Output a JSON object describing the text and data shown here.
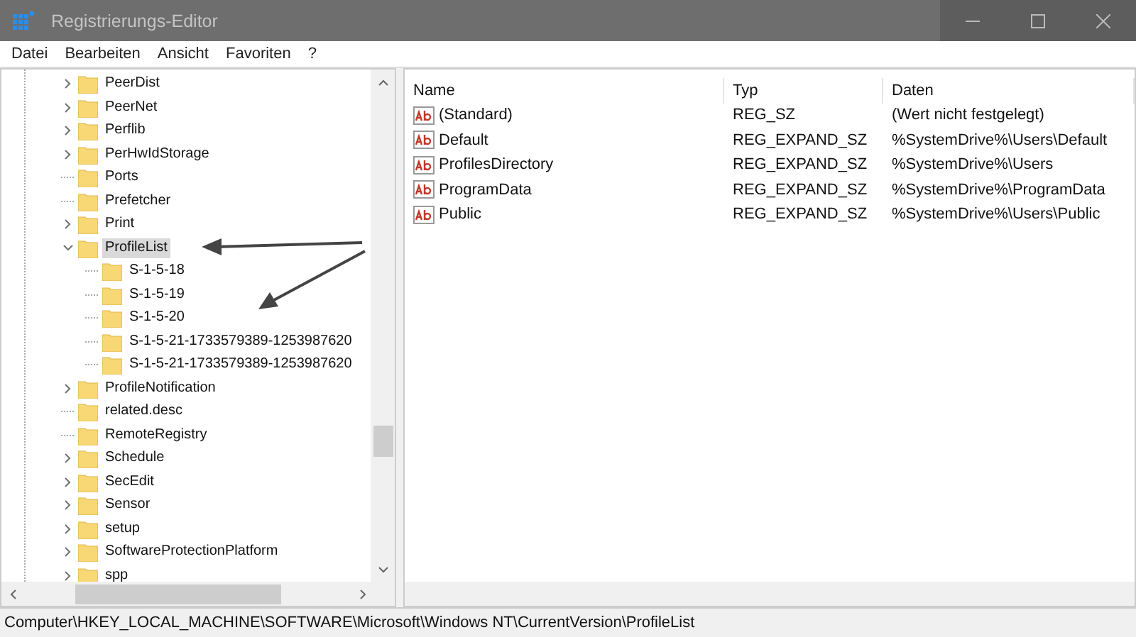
{
  "window": {
    "title": "Registrierungs-Editor"
  },
  "menu": [
    "Datei",
    "Bearbeiten",
    "Ansicht",
    "Favoriten",
    "?"
  ],
  "tree": [
    {
      "label": "PeerDist",
      "kind": "branch",
      "expanded": false,
      "selected": false
    },
    {
      "label": "PeerNet",
      "kind": "branch",
      "expanded": false,
      "selected": false
    },
    {
      "label": "Perflib",
      "kind": "branch",
      "expanded": false,
      "selected": false
    },
    {
      "label": "PerHwIdStorage",
      "kind": "branch",
      "expanded": false,
      "selected": false
    },
    {
      "label": "Ports",
      "kind": "leaf",
      "selected": false
    },
    {
      "label": "Prefetcher",
      "kind": "leaf",
      "selected": false
    },
    {
      "label": "Print",
      "kind": "branch",
      "expanded": false,
      "selected": false
    },
    {
      "label": "ProfileList",
      "kind": "branch",
      "expanded": true,
      "selected": true,
      "children": [
        {
          "label": "S-1-5-18",
          "kind": "leaf",
          "selected": false
        },
        {
          "label": "S-1-5-19",
          "kind": "leaf",
          "selected": false
        },
        {
          "label": "S-1-5-20",
          "kind": "leaf",
          "selected": false
        },
        {
          "label": "S-1-5-21-1733579389-1253987620",
          "kind": "leaf",
          "selected": false
        },
        {
          "label": "S-1-5-21-1733579389-1253987620",
          "kind": "leaf",
          "selected": false
        }
      ]
    },
    {
      "label": "ProfileNotification",
      "kind": "branch",
      "expanded": false,
      "selected": false
    },
    {
      "label": "related.desc",
      "kind": "leaf",
      "selected": false
    },
    {
      "label": "RemoteRegistry",
      "kind": "leaf",
      "selected": false
    },
    {
      "label": "Schedule",
      "kind": "branch",
      "expanded": false,
      "selected": false
    },
    {
      "label": "SecEdit",
      "kind": "branch",
      "expanded": false,
      "selected": false
    },
    {
      "label": "Sensor",
      "kind": "branch",
      "expanded": false,
      "selected": false
    },
    {
      "label": "setup",
      "kind": "branch",
      "expanded": false,
      "selected": false
    },
    {
      "label": "SoftwareProtectionPlatform",
      "kind": "branch",
      "expanded": false,
      "selected": false
    },
    {
      "label": "spp",
      "kind": "branch",
      "expanded": false,
      "selected": false
    }
  ],
  "table": {
    "columns": [
      "Name",
      "Typ",
      "Daten"
    ],
    "rows": [
      {
        "name": "(Standard)",
        "type": "REG_SZ",
        "data": "(Wert nicht festgelegt)"
      },
      {
        "name": "Default",
        "type": "REG_EXPAND_SZ",
        "data": "%SystemDrive%\\Users\\Default"
      },
      {
        "name": "ProfilesDirectory",
        "type": "REG_EXPAND_SZ",
        "data": "%SystemDrive%\\Users"
      },
      {
        "name": "ProgramData",
        "type": "REG_EXPAND_SZ",
        "data": "%SystemDrive%\\ProgramData"
      },
      {
        "name": "Public",
        "type": "REG_EXPAND_SZ",
        "data": "%SystemDrive%\\Users\\Public"
      }
    ]
  },
  "status_bar": "Computer\\HKEY_LOCAL_MACHINE\\SOFTWARE\\Microsoft\\Windows NT\\CurrentVersion\\ProfileList"
}
